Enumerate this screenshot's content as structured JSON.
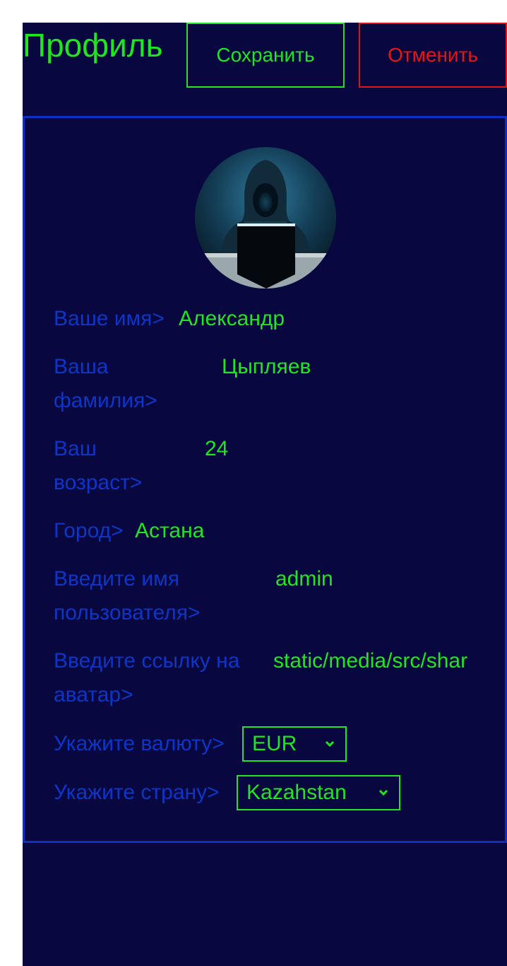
{
  "header": {
    "title": "Профиль",
    "save_label": "Сохранить",
    "cancel_label": "Отменить"
  },
  "profile": {
    "fields": [
      {
        "label": "Ваше имя>",
        "value": "Александр"
      },
      {
        "label": "Ваша фамилия>",
        "value": "Цыпляев"
      },
      {
        "label": "Ваш возраст>",
        "value": "24"
      },
      {
        "label": "Город>",
        "value": "Астана"
      },
      {
        "label": "Введите имя пользователя>",
        "value": "admin"
      },
      {
        "label": "Введите ссылку на аватар>",
        "value": "static/media/src/shar"
      }
    ],
    "currency": {
      "label": "Укажите валюту>",
      "selected": "EUR"
    },
    "country": {
      "label": "Укажите страну>",
      "selected": "Kazahstan"
    }
  },
  "colors": {
    "background": "#08073f",
    "accent_green": "#1fe61f",
    "label_blue": "#0d36c9",
    "cancel_red": "#e81414",
    "card_border": "#0d2fc2"
  }
}
